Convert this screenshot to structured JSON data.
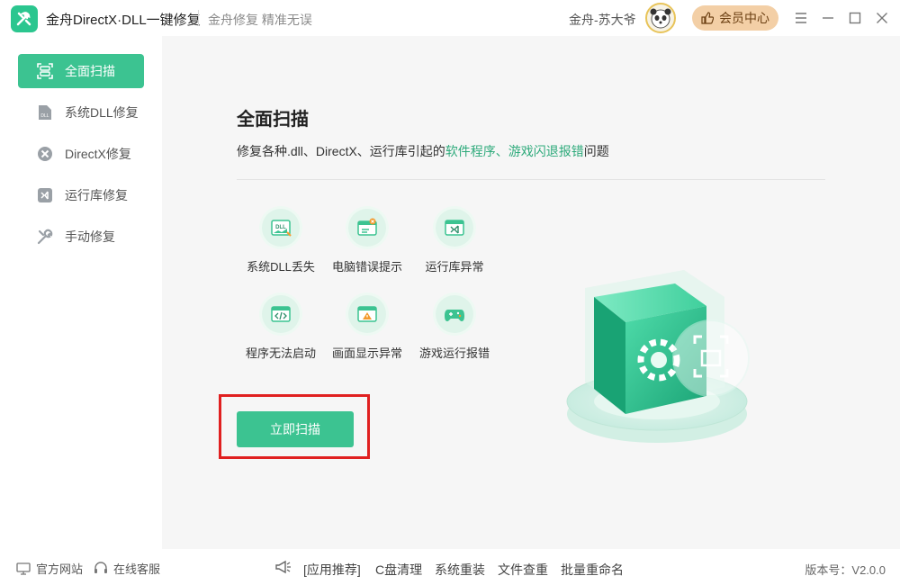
{
  "app": {
    "title": "金舟DirectX·DLL一键修复",
    "slogan": "金舟修复 精准无误"
  },
  "user": {
    "name": "金舟-苏大爷",
    "vip_label": "会员中心"
  },
  "window_controls": [
    "menu-icon",
    "minimize-icon",
    "maximize-icon",
    "close-icon"
  ],
  "sidebar": {
    "items": [
      {
        "label": "全面扫描",
        "icon": "scan-icon",
        "active": true
      },
      {
        "label": "系统DLL修复",
        "icon": "dll-icon",
        "active": false
      },
      {
        "label": "DirectX修复",
        "icon": "directx-icon",
        "active": false
      },
      {
        "label": "运行库修复",
        "icon": "runtime-icon",
        "active": false
      },
      {
        "label": "手动修复",
        "icon": "wrench-icon",
        "active": false
      }
    ]
  },
  "main": {
    "title": "全面扫描",
    "desc_prefix": "修复各种.dll、DirectX、运行库引起的",
    "desc_highlight": "软件程序、游戏闪退报错",
    "desc_suffix": "问题",
    "features": [
      {
        "label": "系统DLL丢失",
        "icon": "dll-file-icon"
      },
      {
        "label": "电脑错误提示",
        "icon": "error-window-icon"
      },
      {
        "label": "运行库异常",
        "icon": "runtime-window-icon"
      },
      {
        "label": "程序无法启动",
        "icon": "code-window-icon"
      },
      {
        "label": "画面显示异常",
        "icon": "warning-window-icon"
      },
      {
        "label": "游戏运行报错",
        "icon": "gamepad-icon"
      }
    ],
    "scan_button": "立即扫描"
  },
  "footer": {
    "official_site": "官方网站",
    "online_service": "在线客服",
    "recommend": "[应用推荐]",
    "links": [
      "C盘清理",
      "系统重装",
      "文件查重",
      "批量重命名"
    ],
    "version": "版本号：V2.0.0"
  },
  "colors": {
    "accent": "#3cc391",
    "highlight_text": "#2eaa7b",
    "vip_bg": "#f3cfa6",
    "annotation_box": "#e02020"
  }
}
